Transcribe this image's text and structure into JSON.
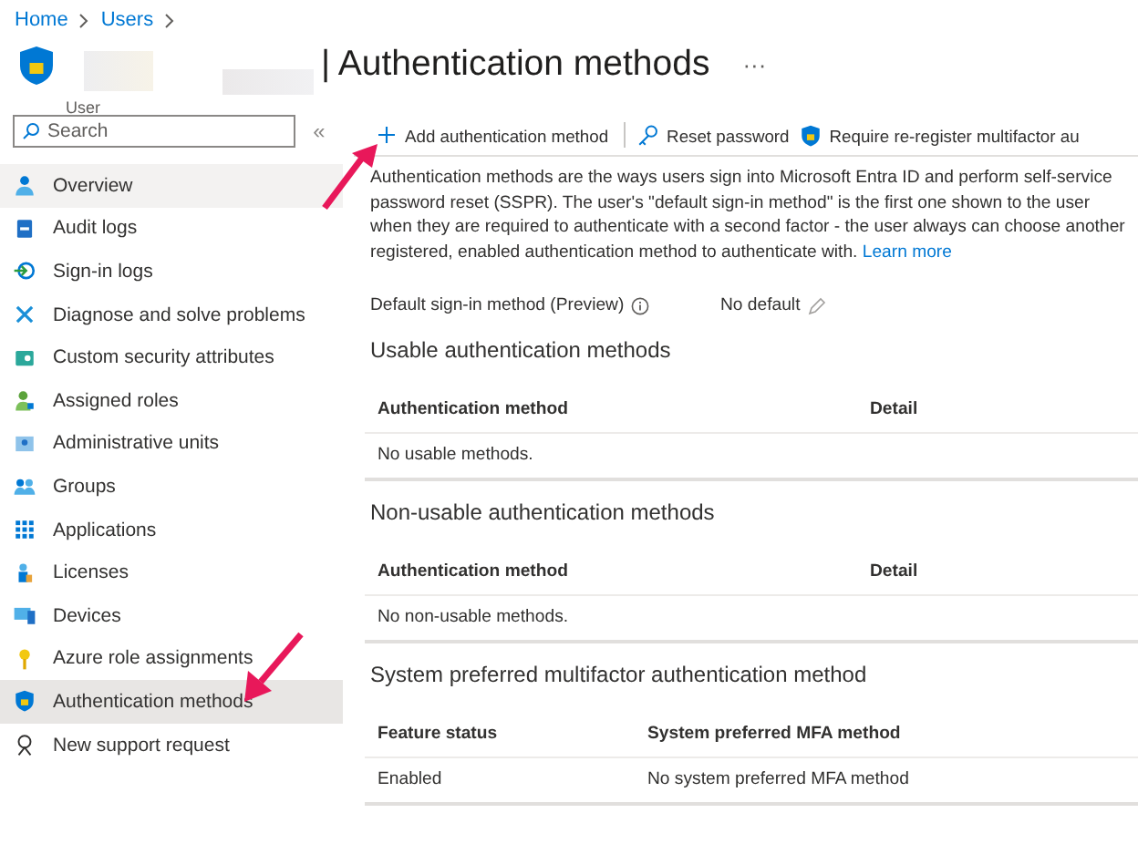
{
  "breadcrumb": [
    {
      "label": "Home"
    },
    {
      "label": "Users"
    }
  ],
  "header": {
    "title": "| Authentication methods",
    "subtitle": "User",
    "more": "···"
  },
  "sidebar": {
    "search": {
      "placeholder": "Search"
    },
    "collapse": "«",
    "items": [
      {
        "label": "Overview",
        "selected": false,
        "highlighted": true
      },
      {
        "label": "Audit logs",
        "selected": false,
        "highlighted": false
      },
      {
        "label": "Sign-in logs",
        "selected": false,
        "highlighted": false
      },
      {
        "label": "Diagnose and solve problems",
        "selected": false,
        "highlighted": false
      },
      {
        "label": "Custom security attributes",
        "selected": false,
        "highlighted": false
      },
      {
        "label": "Assigned roles",
        "selected": false,
        "highlighted": false
      },
      {
        "label": "Administrative units",
        "selected": false,
        "highlighted": false
      },
      {
        "label": "Groups",
        "selected": false,
        "highlighted": false
      },
      {
        "label": "Applications",
        "selected": false,
        "highlighted": false
      },
      {
        "label": "Licenses",
        "selected": false,
        "highlighted": false
      },
      {
        "label": "Devices",
        "selected": false,
        "highlighted": false
      },
      {
        "label": "Azure role assignments",
        "selected": false,
        "highlighted": false
      },
      {
        "label": "Authentication methods",
        "selected": true,
        "highlighted": false
      },
      {
        "label": "New support request",
        "selected": false,
        "highlighted": false
      }
    ]
  },
  "toolbar": [
    {
      "label": "Add authentication method"
    },
    {
      "label": "Reset password"
    },
    {
      "label": "Require re-register multifactor au"
    }
  ],
  "description": {
    "text": "Authentication methods are the ways users sign into Microsoft Entra ID and perform self-service password reset (SSPR). The user's \"default sign-in method\" is the first one shown to the user when they are required to authenticate with a second factor - the user always can choose another registered, enabled authentication method to authenticate with.",
    "link": "Learn more"
  },
  "default_method": {
    "label": "Default sign-in method (Preview)",
    "value": "No default"
  },
  "sections": [
    {
      "title": "Usable authentication methods",
      "columns": [
        "Authentication method",
        "Detail"
      ],
      "rows": [
        [
          "No usable methods."
        ]
      ]
    },
    {
      "title": "Non-usable authentication methods",
      "columns": [
        "Authentication method",
        "Detail"
      ],
      "rows": [
        [
          "No non-usable methods."
        ]
      ]
    },
    {
      "title": "System preferred multifactor authentication method",
      "columns": [
        "Feature status",
        "System preferred MFA method"
      ],
      "rows": [
        [
          "Enabled",
          "No system preferred MFA method"
        ]
      ]
    }
  ]
}
